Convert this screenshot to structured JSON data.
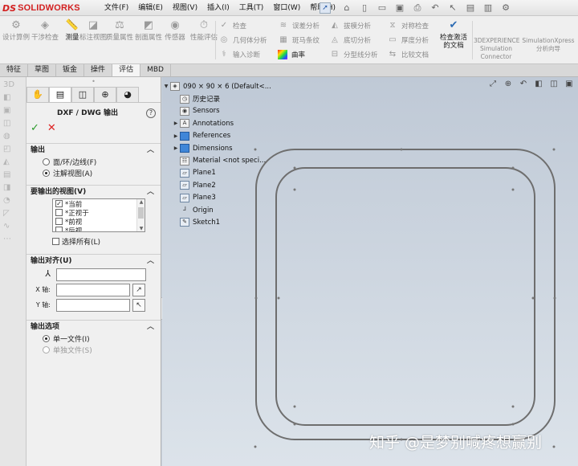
{
  "app": {
    "brand_prefix": "DS",
    "brand_name": "SOLIDWORKS"
  },
  "menu": [
    "文件(F)",
    "编辑(E)",
    "视图(V)",
    "插入(I)",
    "工具(T)",
    "窗口(W)",
    "帮助(H)"
  ],
  "commands": {
    "interference": "干涉检查",
    "measure": "测量",
    "mark_view": "标注视图",
    "mass_props": "质量属性",
    "section_props": "剖面属性",
    "sensor": "传感器",
    "perf_eval": "性能评估",
    "check": "检查",
    "geometry_analysis": "几何体分析",
    "import_diag": "输入诊断",
    "deviation": "误差分析",
    "zebra": "斑马条纹",
    "curvature": "曲率",
    "draft": "拔模分析",
    "undercut": "底切分析",
    "parting_line": "分型线分析",
    "symmetry": "对称检查",
    "thickness": "厚度分析",
    "compare": "比较文档",
    "check_active": "检查激活的文档",
    "experience": "3DEXPERIENCE Simulation Connector",
    "simxpress": "SimulationXpress 分析向导",
    "design_study": "设计算例"
  },
  "tabs": [
    "特征",
    "草图",
    "钣金",
    "操件",
    "评估",
    "MBD"
  ],
  "pm": {
    "title": "DXF / DWG 输出",
    "output_group": "输出",
    "radio_faces": "面/环/边线(F)",
    "radio_annot": "注解视图(A)",
    "views_group": "要输出的视图(V)",
    "views": [
      {
        "label": "*当前",
        "checked": true
      },
      {
        "label": "*正视于",
        "checked": false
      },
      {
        "label": "*前视",
        "checked": false
      },
      {
        "label": "*后视",
        "checked": false
      }
    ],
    "select_all": "选择所有(L)",
    "align_group": "输出对齐(U)",
    "x_axis": "X 轴:",
    "y_axis": "Y 轴:",
    "options_group": "输出选项",
    "single_file": "单一文件(I)",
    "separate_files": "单独文件(S)"
  },
  "tree": {
    "part": "090 × 90 × 6  (Default<...",
    "history": "历史记录",
    "sensors": "Sensors",
    "annotations": "Annotations",
    "references": "References",
    "dimensions": "Dimensions",
    "material": "Material <not speci...",
    "plane1": "Plane1",
    "plane2": "Plane2",
    "plane3": "Plane3",
    "origin": "Origin",
    "sketch1": "Sketch1"
  },
  "watermark": "知乎 @是梦别喊疼想赢别",
  "colors": {
    "brand_red": "#d32020",
    "ok_green": "#2a9a2a",
    "cancel_red": "#dd2222",
    "viewport_top": "#bfc9d6",
    "viewport_bottom": "#dce3ea",
    "sketch_line": "#6e6e6e"
  }
}
